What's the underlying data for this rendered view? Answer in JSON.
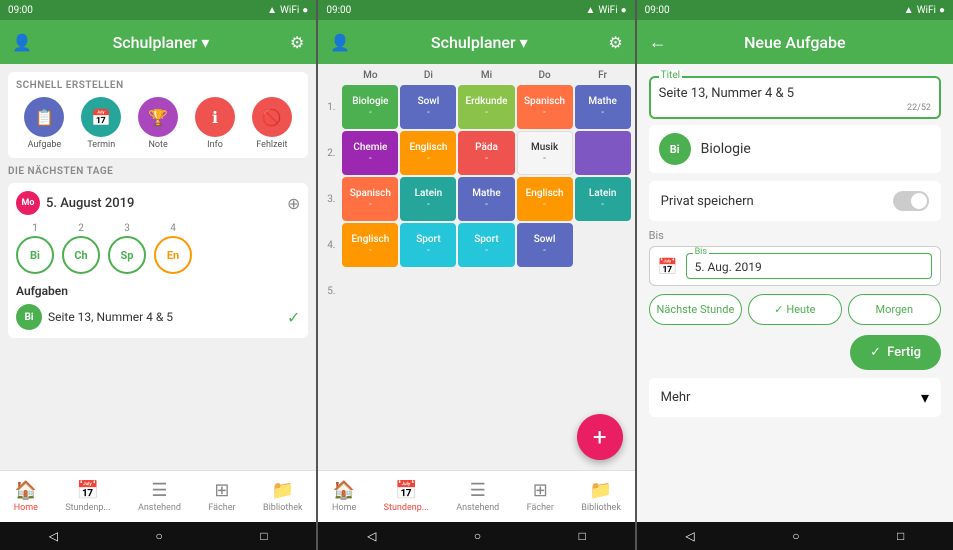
{
  "phone1": {
    "status": {
      "time": "09:00"
    },
    "appbar": {
      "user_icon": "👤",
      "title": "Schulplaner",
      "arrow": "▾",
      "settings_icon": "⚙"
    },
    "quick_create": {
      "label": "SCHNELL ERSTELLEN",
      "items": [
        {
          "icon": "📋",
          "color": "#5c6bc0",
          "label": "Aufgabe"
        },
        {
          "icon": "📅",
          "color": "#26a69a",
          "label": "Termin"
        },
        {
          "icon": "🏆",
          "color": "#ab47bc",
          "label": "Note"
        },
        {
          "icon": "ℹ",
          "color": "#ef5350",
          "label": "Info"
        },
        {
          "icon": "🚫",
          "color": "#ef5350",
          "label": "Fehlzeit"
        }
      ]
    },
    "next_days": {
      "label": "DIE NÄCHSTEN TAGE",
      "date_badge": "Mo",
      "date": "5. August 2019",
      "subjects": [
        {
          "num": "1",
          "short": "Bi",
          "color": "#4caf50"
        },
        {
          "num": "2",
          "short": "Ch",
          "color": "#4caf50"
        },
        {
          "num": "3",
          "short": "Sp",
          "color": "#4caf50"
        },
        {
          "num": "4",
          "short": "En",
          "color": "#ff9800"
        }
      ],
      "aufgaben_title": "Aufgaben",
      "task": {
        "badge": "Bi",
        "text": "Seite 13, Nummer 4 & 5"
      }
    },
    "bottom_nav": [
      {
        "icon": "🏠",
        "label": "Home",
        "active": true
      },
      {
        "icon": "📅",
        "label": "Stundenp...",
        "active": false
      },
      {
        "icon": "☰",
        "label": "Anstehend",
        "active": false
      },
      {
        "icon": "⊞",
        "label": "Fächer",
        "active": false
      },
      {
        "icon": "📁",
        "label": "Bibliothek",
        "active": false
      }
    ]
  },
  "phone2": {
    "status": {
      "time": "09:00"
    },
    "appbar": {
      "user_icon": "👤",
      "title": "Schulplaner",
      "arrow": "▾",
      "settings_icon": "⚙"
    },
    "timetable": {
      "headers": [
        "Mo",
        "Di",
        "Mi",
        "Do",
        "Fr"
      ],
      "rows": [
        {
          "num": "1.",
          "cells": [
            {
              "subject": "Biologie",
              "sub": "-",
              "color": "#4caf50"
            },
            {
              "subject": "Sowl",
              "sub": "-",
              "color": "#5c6bc0"
            },
            {
              "subject": "Erdkunde",
              "sub": "-",
              "color": "#8bc34a"
            },
            {
              "subject": "Spanisch",
              "sub": "-",
              "color": "#ff7043"
            },
            {
              "subject": "Mathe",
              "sub": "-",
              "color": "#5c6bc0"
            }
          ]
        },
        {
          "num": "2.",
          "cells": [
            {
              "subject": "Chemie",
              "sub": "-",
              "color": "#9c27b0"
            },
            {
              "subject": "Englisch",
              "sub": "-",
              "color": "#ff9800"
            },
            {
              "subject": "Päda",
              "sub": "-",
              "color": "#ef5350"
            },
            {
              "subject": "Musik",
              "sub": "-",
              "color": "#ffffff",
              "dark": true
            },
            {
              "subject": "",
              "sub": "",
              "color": "#7e57c2"
            }
          ]
        },
        {
          "num": "3.",
          "cells": [
            {
              "subject": "Spanisch",
              "sub": "-",
              "color": "#ff7043"
            },
            {
              "subject": "Latein",
              "sub": "-",
              "color": "#26a69a"
            },
            {
              "subject": "Mathe",
              "sub": "-",
              "color": "#5c6bc0"
            },
            {
              "subject": "Englisch",
              "sub": "-",
              "color": "#ff9800"
            },
            {
              "subject": "Latein",
              "sub": "-",
              "color": "#26a69a"
            }
          ]
        },
        {
          "num": "4.",
          "cells": [
            {
              "subject": "Englisch",
              "sub": "-",
              "color": "#ff9800"
            },
            {
              "subject": "Sport",
              "sub": "-",
              "color": "#26c6da"
            },
            {
              "subject": "Sport",
              "sub": "-",
              "color": "#26c6da"
            },
            {
              "subject": "Sowl",
              "sub": "-",
              "color": "#5c6bc0"
            },
            {
              "subject": "",
              "sub": "",
              "color": "transparent"
            }
          ]
        },
        {
          "num": "5.",
          "cells": [
            {
              "subject": "",
              "sub": "",
              "color": "transparent"
            },
            {
              "subject": "",
              "sub": "",
              "color": "transparent"
            },
            {
              "subject": "",
              "sub": "",
              "color": "transparent"
            },
            {
              "subject": "",
              "sub": "",
              "color": "transparent"
            },
            {
              "subject": "",
              "sub": "",
              "color": "transparent"
            }
          ]
        }
      ]
    },
    "fab": "+",
    "bottom_nav": [
      {
        "icon": "🏠",
        "label": "Home",
        "active": false
      },
      {
        "icon": "📅",
        "label": "Stundenp...",
        "active": true
      },
      {
        "icon": "☰",
        "label": "Anstehend",
        "active": false
      },
      {
        "icon": "⊞",
        "label": "Fächer",
        "active": false
      },
      {
        "icon": "📁",
        "label": "Bibliothek",
        "active": false
      }
    ]
  },
  "phone3": {
    "status": {
      "time": "09:00"
    },
    "appbar": {
      "back_icon": "←",
      "title": "Neue Aufgabe"
    },
    "titel_label": "Titel",
    "titel_value": "Seite 13, Nummer 4 & 5",
    "char_count": "22/52",
    "subject_badge": "Bi",
    "subject_name": "Biologie",
    "privat_label": "Privat speichern",
    "bis_section_label": "Bis",
    "bis_inner_label": "Bis",
    "bis_date": "5. Aug. 2019",
    "action_buttons": [
      {
        "label": "Nächste Stunde"
      },
      {
        "label": "✓  Heute",
        "active": true
      },
      {
        "label": "Morgen"
      }
    ],
    "fertig_label": "✓  Fertig",
    "mehr_label": "Mehr",
    "mehr_arrow": "▾"
  }
}
